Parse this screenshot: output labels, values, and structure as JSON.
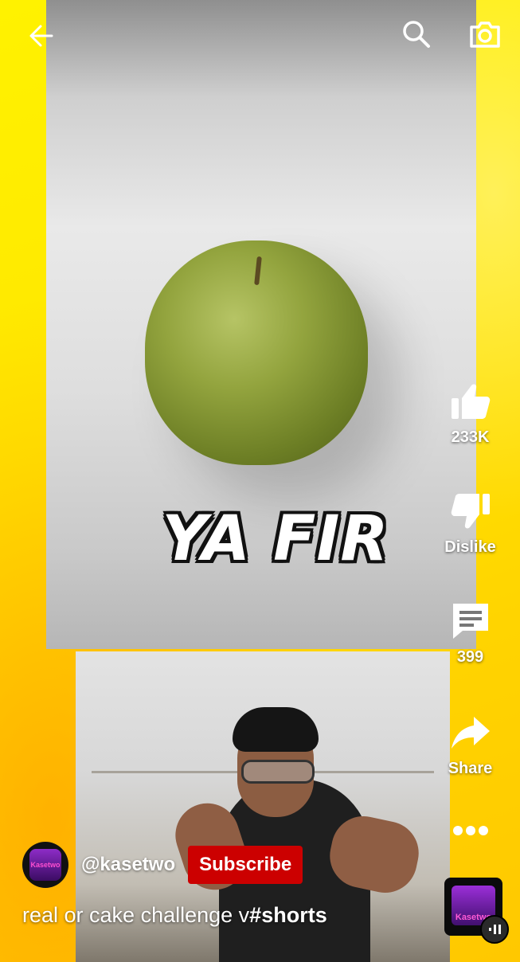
{
  "top_bar": {
    "back_icon": "arrow-left-icon",
    "search_icon": "search-icon",
    "camera_icon": "camera-icon"
  },
  "video": {
    "overlay_text": "YA FIR"
  },
  "actions": {
    "like_count": "233K",
    "dislike_label": "Dislike",
    "comment_count": "399",
    "share_label": "Share"
  },
  "channel": {
    "avatar_text": "Kasetwo",
    "handle": "@kasetwo",
    "subscribe_label": "Subscribe"
  },
  "title": {
    "text": "real or cake challenge v",
    "hashtag": "#shorts"
  },
  "sound": {
    "thumb_text": "Kasetwo"
  },
  "colors": {
    "subscribe_red": "#cc0000",
    "background_yellow": "#ffe600"
  }
}
